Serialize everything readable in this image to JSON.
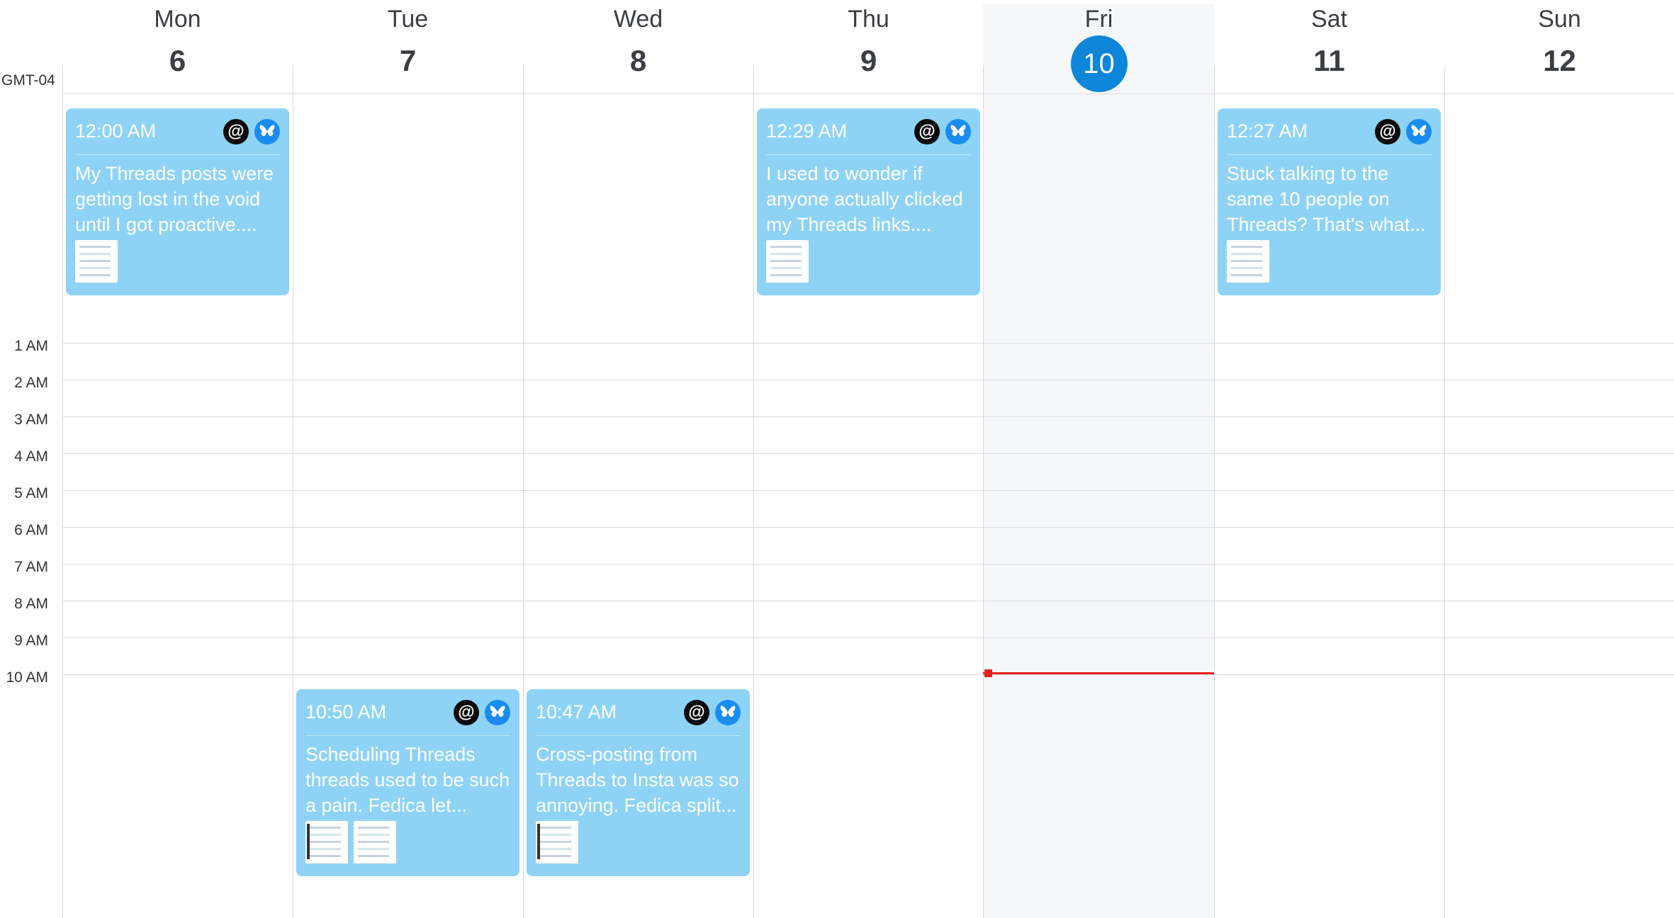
{
  "timezone": "GMT-04",
  "days": [
    {
      "name": "Mon",
      "number": "6"
    },
    {
      "name": "Tue",
      "number": "7"
    },
    {
      "name": "Wed",
      "number": "8"
    },
    {
      "name": "Thu",
      "number": "9"
    },
    {
      "name": "Fri",
      "number": "10",
      "today": true
    },
    {
      "name": "Sat",
      "number": "11"
    },
    {
      "name": "Sun",
      "number": "12"
    }
  ],
  "hours": [
    "1 AM",
    "2 AM",
    "3 AM",
    "4 AM",
    "5 AM",
    "6 AM",
    "7 AM",
    "8 AM",
    "9 AM",
    "10 AM"
  ],
  "colors": {
    "event": "#8ed3f5",
    "today_badge": "#0d85d8",
    "now_line": "#e81f1f"
  },
  "events": [
    {
      "day": "Mon",
      "time": "12:00 AM",
      "text": "My Threads posts were getting lost in the void until I got proactive....",
      "platforms": [
        "threads-icon",
        "bluesky-icon"
      ],
      "thumbnails": 1
    },
    {
      "day": "Thu",
      "time": "12:29 AM",
      "text": "I used to wonder if anyone actually clicked my Threads links....",
      "platforms": [
        "threads-icon",
        "bluesky-icon"
      ],
      "thumbnails": 1
    },
    {
      "day": "Sat",
      "time": "12:27 AM",
      "text": "Stuck talking to the same 10 people on Threads? That's what...",
      "platforms": [
        "threads-icon",
        "bluesky-icon"
      ],
      "thumbnails": 1
    },
    {
      "day": "Tue",
      "time": "10:50 AM",
      "text": "Scheduling Threads threads used to be such a pain. Fedica let...",
      "platforms": [
        "threads-icon",
        "bluesky-icon"
      ],
      "thumbnails": 2
    },
    {
      "day": "Wed",
      "time": "10:47 AM",
      "text": "Cross-posting from Threads to Insta was so annoying. Fedica split...",
      "platforms": [
        "threads-icon",
        "bluesky-icon"
      ],
      "thumbnails": 1
    }
  ]
}
